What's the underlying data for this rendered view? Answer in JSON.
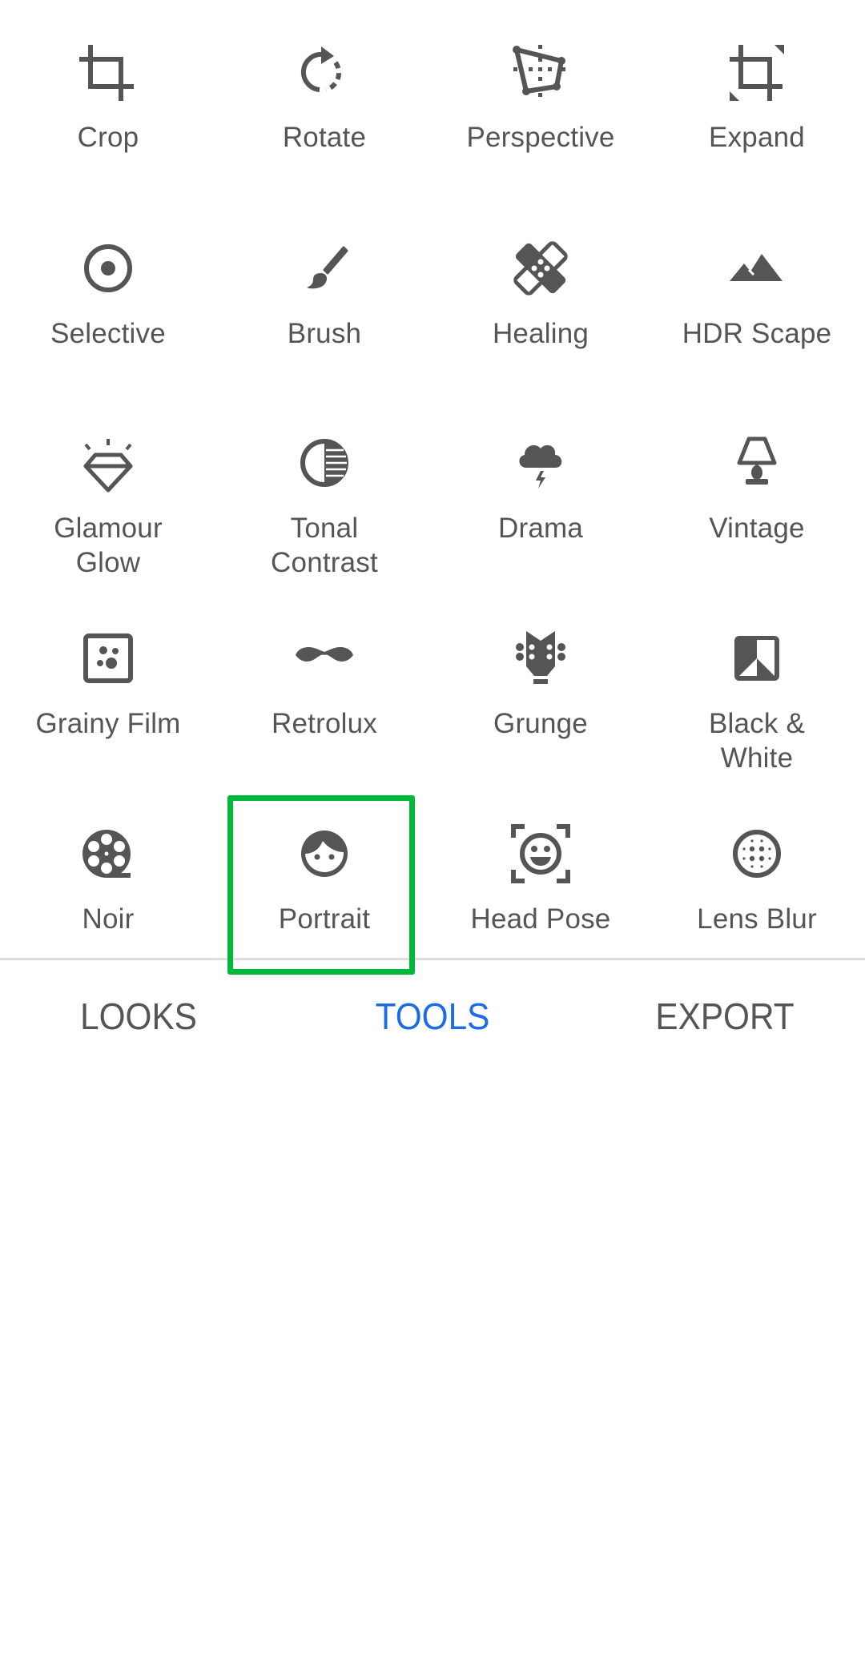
{
  "tools_grid": [
    {
      "label": "Crop",
      "icon": "crop-icon"
    },
    {
      "label": "Rotate",
      "icon": "rotate-icon"
    },
    {
      "label": "Perspective",
      "icon": "perspective-icon"
    },
    {
      "label": "Expand",
      "icon": "expand-icon"
    },
    {
      "label": "Selective",
      "icon": "selective-icon"
    },
    {
      "label": "Brush",
      "icon": "brush-icon"
    },
    {
      "label": "Healing",
      "icon": "healing-bandage-icon"
    },
    {
      "label": "HDR Scape",
      "icon": "mountain-icon"
    },
    {
      "label": "Glamour\nGlow",
      "icon": "diamond-icon"
    },
    {
      "label": "Tonal\nContrast",
      "icon": "tonal-contrast-icon"
    },
    {
      "label": "Drama",
      "icon": "storm-cloud-icon"
    },
    {
      "label": "Vintage",
      "icon": "lamp-icon"
    },
    {
      "label": "Grainy Film",
      "icon": "grainy-film-icon"
    },
    {
      "label": "Retrolux",
      "icon": "mustache-icon"
    },
    {
      "label": "Grunge",
      "icon": "guitar-head-icon"
    },
    {
      "label": "Black &\nWhite",
      "icon": "black-white-icon"
    },
    {
      "label": "Noir",
      "icon": "film-reel-icon"
    },
    {
      "label": "Portrait",
      "icon": "face-icon"
    },
    {
      "label": "Head Pose",
      "icon": "face-frame-icon"
    },
    {
      "label": "Lens Blur",
      "icon": "lens-blur-icon"
    }
  ],
  "highlighted_tool": "Portrait",
  "bottom_tabs": [
    {
      "label": "LOOKS",
      "active": false
    },
    {
      "label": "TOOLS",
      "active": true
    },
    {
      "label": "EXPORT",
      "active": false
    }
  ],
  "colors": {
    "icon_text": "#555555",
    "active_tab": "#1a6ce8",
    "highlight_box": "#00b93b",
    "divider": "#dddddd"
  }
}
